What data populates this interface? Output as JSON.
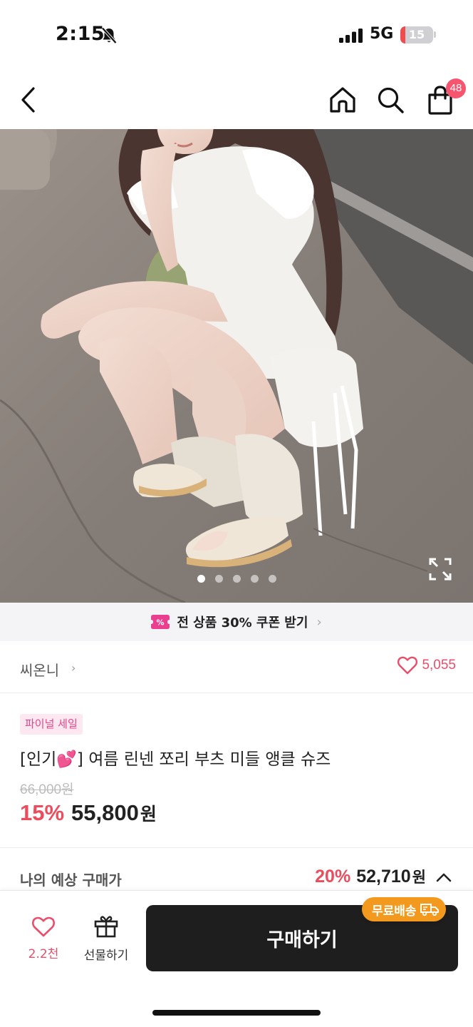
{
  "status_bar": {
    "time": "2:15",
    "network": "5G",
    "battery_level": "15",
    "battery_fraction": 0.15
  },
  "nav": {
    "icons": [
      "back-arrow-icon",
      "home-icon",
      "search-icon",
      "shopping-bag-icon"
    ],
    "cart_count": "48"
  },
  "gallery": {
    "total_images": 5,
    "active_index": 0
  },
  "coupon": {
    "text": "전 상품 30% 쿠폰 받기"
  },
  "brand": {
    "name": "씨온니",
    "likes": "5,055"
  },
  "product": {
    "sale_tag": "파이널 세일",
    "title": "[인기💕] 여름 린넨 쪼리 부츠 미들 앵클 슈즈",
    "original_price": "66,000원",
    "discount": "15%",
    "price": "55,800",
    "currency": "원"
  },
  "estimate": {
    "label": "나의 예상 구매가",
    "discount": "20%",
    "price": "52,710",
    "currency": "원"
  },
  "bottom_bar": {
    "wish_count": "2.2천",
    "gift_label": "선물하기",
    "buy_label": "구매하기",
    "free_shipping": "무료배송"
  },
  "colors": {
    "accent_pink": "#ec4d6a",
    "price_red": "#ec4d5e",
    "buy_button": "#1e1e1e",
    "free_shipping_badge": "#f39a1e"
  }
}
